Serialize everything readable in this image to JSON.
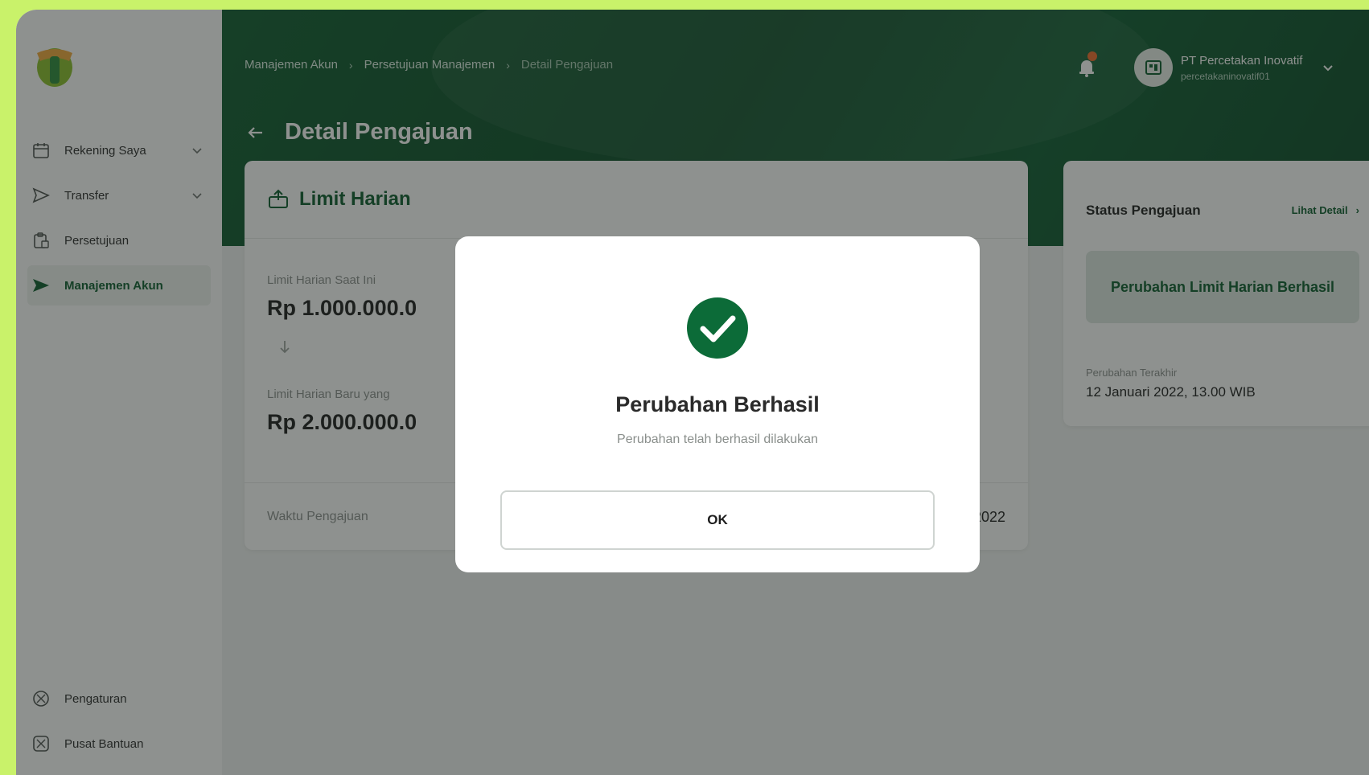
{
  "colors": {
    "background": "#c9f26a",
    "brand_green": "#0b5a2c",
    "success_green": "#0c6b38",
    "notification_dot": "#f06a2a"
  },
  "sidebar": {
    "items": [
      {
        "label": "Rekening Saya",
        "icon": "calendar-icon",
        "expandable": true
      },
      {
        "label": "Transfer",
        "icon": "send-icon",
        "expandable": true
      },
      {
        "label": "Persetujuan",
        "icon": "clipboard-icon",
        "expandable": false
      },
      {
        "label": "Manajemen Akun",
        "icon": "send-icon",
        "expandable": false,
        "active": true
      }
    ],
    "bottom_items": [
      {
        "label": "Pengaturan",
        "icon": "settings-icon"
      },
      {
        "label": "Pusat Bantuan",
        "icon": "help-icon"
      }
    ]
  },
  "header": {
    "breadcrumb": [
      "Manajemen Akun",
      "Persetujuan Manajemen",
      "Detail Pengajuan"
    ],
    "page_title": "Detail Pengajuan",
    "profile": {
      "name": "PT Percetakan Inovatif",
      "username": "percetakaninovatif01"
    }
  },
  "limit_card": {
    "title": "Limit Harian",
    "current_label": "Limit Harian Saat Ini",
    "current_value": "Rp 1.000.000.0",
    "new_label": "Limit Harian Baru yang",
    "new_value": "Rp 2.000.000.0",
    "submission_time_label": "Waktu Pengajuan",
    "submission_time_value": "2022"
  },
  "status_card": {
    "title": "Status Pengajuan",
    "link": "Lihat Detail",
    "status": "Perubahan Limit Harian Berhasil",
    "last_change_label": "Perubahan Terakhir",
    "last_change_value": "12 Januari 2022, 13.00 WIB"
  },
  "modal": {
    "icon": "check-circle-icon",
    "title": "Perubahan Berhasil",
    "subtitle": "Perubahan telah berhasil dilakukan",
    "ok_label": "OK"
  }
}
